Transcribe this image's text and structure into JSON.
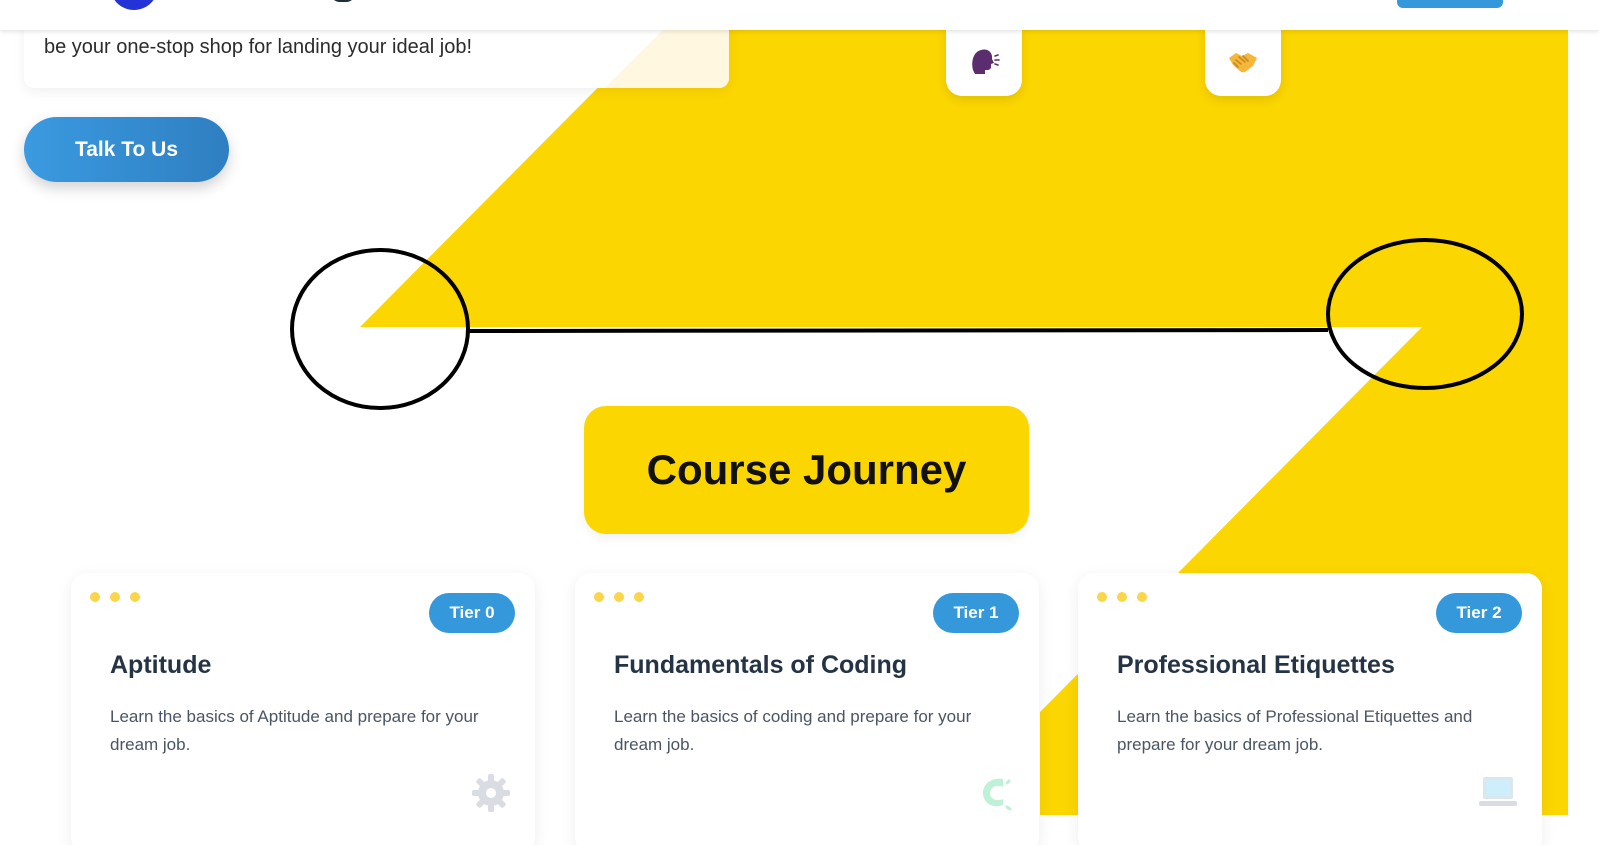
{
  "colors": {
    "accent_yellow": "#FCD600",
    "primary_blue": "#3498DB",
    "heading_dark": "#253445",
    "dot_yellow": "#FBD54A",
    "annotation_black": "#000000"
  },
  "hero": {
    "text": "be your one-stop shop for landing your ideal job!",
    "cta_label": "Talk To Us"
  },
  "icons": {
    "tile_1": "speaking-head-icon",
    "tile_2": "handshake-icon"
  },
  "section": {
    "title": "Course Journey"
  },
  "courses": [
    {
      "tier": "Tier 0",
      "title": "Aptitude",
      "description": "Learn the basics of Aptitude and prepare for your dream job.",
      "icon": "gear-icon"
    },
    {
      "tier": "Tier 1",
      "title": "Fundamentals of Coding",
      "description": "Learn the basics of coding and prepare for your dream job.",
      "icon": "code-icon"
    },
    {
      "tier": "Tier 2",
      "title": "Professional Etiquettes",
      "description": "Learn the basics of Professional Etiquettes and prepare for your dream job.",
      "icon": "laptop-icon"
    }
  ]
}
